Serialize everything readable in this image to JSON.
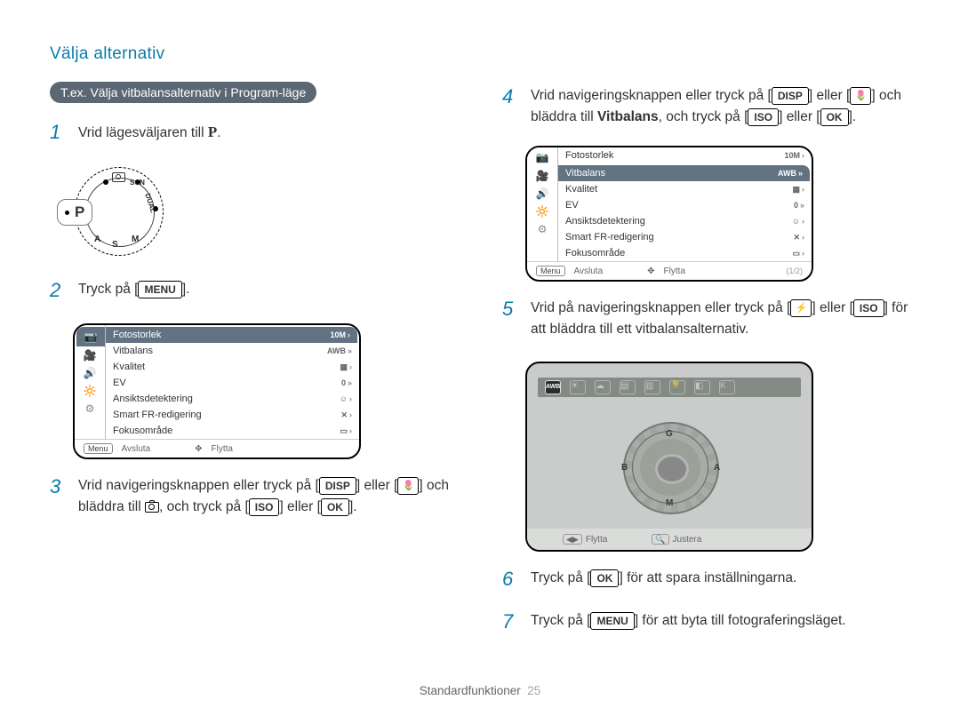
{
  "page_header": "Välja alternativ",
  "badge": "T.ex. Välja vitbalansalternativ i Program-läge",
  "dial": {
    "selected": "P",
    "labels": [
      "SCN",
      "DUAL",
      "A",
      "S",
      "M"
    ]
  },
  "steps": {
    "s1_pre": "Vrid lägesväljaren till ",
    "s1_mode": "P",
    "s2_pre": "Tryck på [",
    "s2_btn": "MENU",
    "s2_post": "].",
    "s3_pre": "Vrid navigeringsknappen eller tryck på [",
    "s3_b1": "DISP",
    "s3_mid": "] eller [",
    "s3_macro": "🌷",
    "s3_post1": "] och bläddra till ",
    "s3_cam": "📷",
    "s3_post2": ", och tryck på [",
    "s3_iso": "ISO",
    "s3_post3": "] eller [",
    "s3_ok": "OK",
    "s3_end": "].",
    "s4_pre": "Vrid navigeringsknappen eller tryck på [",
    "s4_b1": "DISP",
    "s4_mid": "] eller [",
    "s4_macro": "🌷",
    "s4_post1": "] och bläddra till ",
    "s4_bold": "Vitbalans",
    "s4_post2": ", och tryck på [",
    "s4_iso": "ISO",
    "s4_post3": "] eller [",
    "s4_ok": "OK",
    "s4_end": "].",
    "s5_pre": "Vrid på navigeringsknappen eller tryck på [",
    "s5_flash": "⚡",
    "s5_mid": "] eller [",
    "s5_iso": "ISO",
    "s5_post": "] för att bläddra till ett vitbalansalternativ.",
    "s6_pre": "Tryck på [",
    "s6_ok": "OK",
    "s6_post": "] för att spara inställningarna.",
    "s7_pre": "Tryck på [",
    "s7_menu": "MENU",
    "s7_post": "] för att byta till fotograferingsläget."
  },
  "lcd1": {
    "selected_idx": 0,
    "rows": [
      {
        "label": "Fotostorlek",
        "val": "10M",
        "chev": "›"
      },
      {
        "label": "Vitbalans",
        "val": "AWB",
        "chev": "»"
      },
      {
        "label": "Kvalitet",
        "val": "▦",
        "chev": "›"
      },
      {
        "label": "EV",
        "val": "0",
        "chev": "»"
      },
      {
        "label": "Ansiktsdetektering",
        "val": "☺",
        "chev": "›"
      },
      {
        "label": "Smart FR-redigering",
        "val": "✕",
        "chev": "›"
      },
      {
        "label": "Fokusområde",
        "val": "▭",
        "chev": "›"
      }
    ],
    "footer_menu": "Menu",
    "footer_exit": "Avsluta",
    "footer_move_sym": "✥",
    "footer_move": "Flytta",
    "footer_page": ""
  },
  "lcd2": {
    "selected_idx": 1,
    "rows": [
      {
        "label": "Fotostorlek",
        "val": "10M",
        "chev": "›"
      },
      {
        "label": "Vitbalans",
        "val": "AWB",
        "chev": "»"
      },
      {
        "label": "Kvalitet",
        "val": "▦",
        "chev": "›"
      },
      {
        "label": "EV",
        "val": "0",
        "chev": "»"
      },
      {
        "label": "Ansiktsdetektering",
        "val": "☺",
        "chev": "›"
      },
      {
        "label": "Smart FR-redigering",
        "val": "✕",
        "chev": "›"
      },
      {
        "label": "Fokusområde",
        "val": "▭",
        "chev": "›"
      }
    ],
    "footer_menu": "Menu",
    "footer_exit": "Avsluta",
    "footer_move_sym": "✥",
    "footer_move": "Flytta",
    "footer_page": "(1/2)"
  },
  "wb": {
    "selected_label": "AWB",
    "nav_letters": {
      "t": "G",
      "r": "A",
      "b": "M",
      "l": "B"
    },
    "footer_move_sym": "◀▶",
    "footer_move": "Flytta",
    "footer_adjust_sym": "🔍",
    "footer_adjust": "Justera"
  },
  "left_icons": [
    "📷",
    "🎥",
    "🔊",
    "🔆",
    "⚙"
  ],
  "footer": {
    "section": "Standardfunktioner",
    "page": "25"
  }
}
